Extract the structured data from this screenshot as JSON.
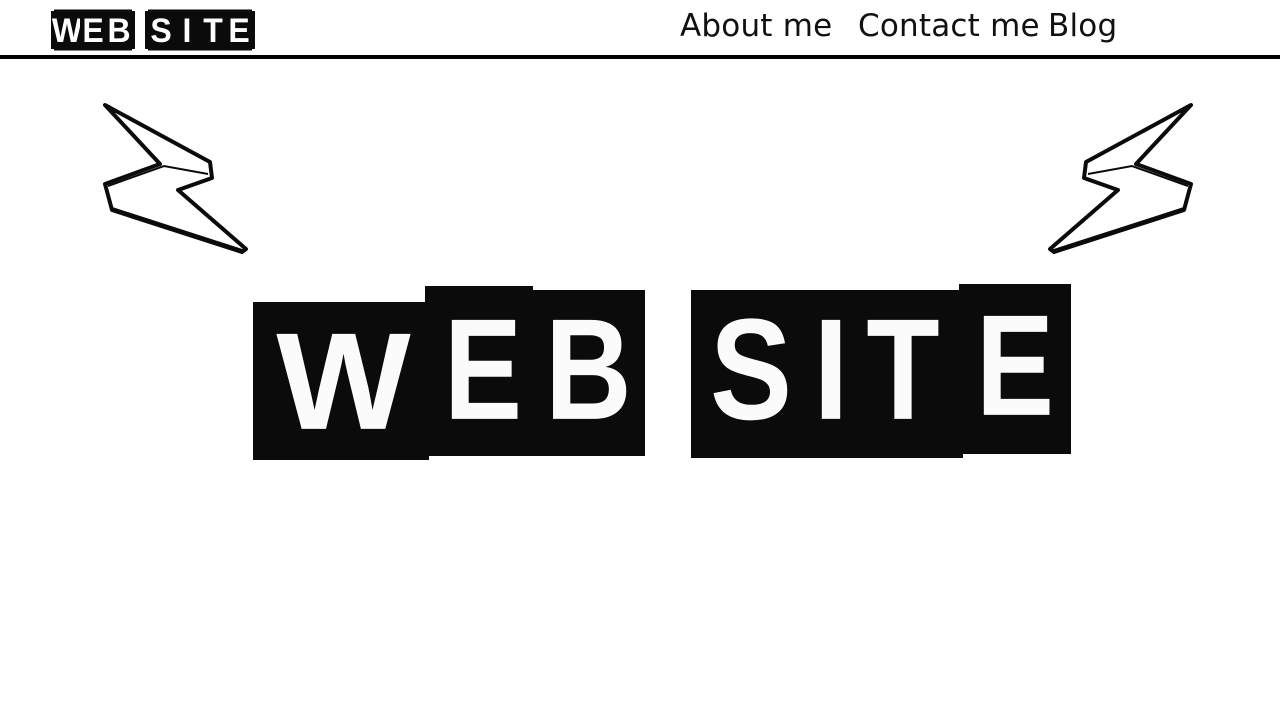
{
  "header": {
    "logo": {
      "word1": [
        "W",
        "E",
        "B"
      ],
      "word2": [
        "S",
        "I",
        "T",
        "E"
      ]
    },
    "nav": {
      "about": "About me",
      "contact": "Contact me",
      "blog": "Blog"
    }
  },
  "hero": {
    "title_letters": [
      "W",
      "E",
      "B",
      "S",
      "I",
      "T",
      "E"
    ],
    "bolt_icon_left": "lightning-bolt-icon",
    "bolt_icon_right": "lightning-bolt-icon"
  },
  "colors": {
    "background": "#ffffff",
    "ink": "#0b0b0b",
    "letter": "#fbfbfb"
  }
}
